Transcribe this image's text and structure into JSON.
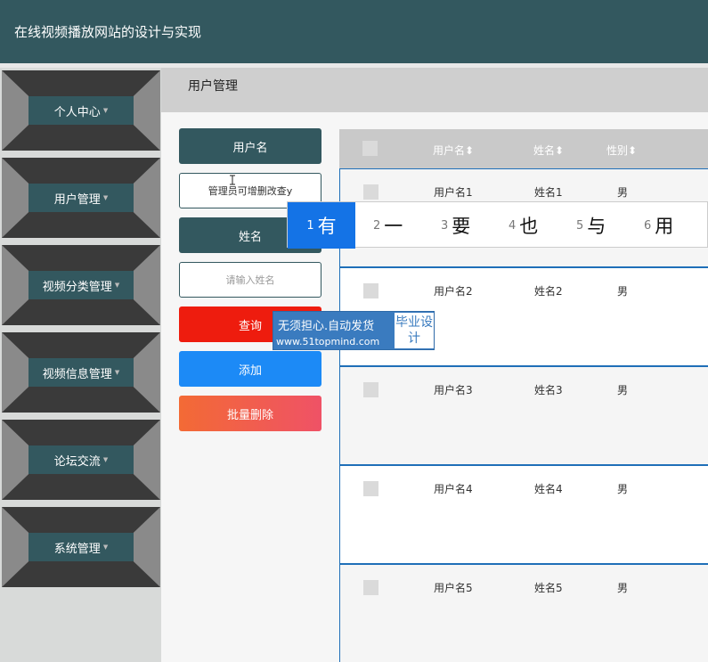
{
  "header": {
    "title": "在线视频播放网站的设计与实现"
  },
  "sidebar": {
    "items": [
      {
        "label": "个人中心"
      },
      {
        "label": "用户管理"
      },
      {
        "label": "视频分类管理"
      },
      {
        "label": "视频信息管理"
      },
      {
        "label": "论坛交流"
      },
      {
        "label": "系统管理"
      }
    ],
    "caret": "▼"
  },
  "breadcrumb": {
    "current": "用户管理"
  },
  "search_form": {
    "username_label": "用户名",
    "username_value": "管理员可增删改查y",
    "name_label": "姓名",
    "name_placeholder": "请输入姓名",
    "search_button": "查询",
    "add_button": "添加",
    "batch_delete_button": "批量删除"
  },
  "table": {
    "columns": [
      "用户名",
      "姓名",
      "性别"
    ],
    "sort_icon": "⬍",
    "rows": [
      {
        "username": "用户名1",
        "name": "姓名1",
        "gender": "男"
      },
      {
        "username": "用户名2",
        "name": "姓名2",
        "gender": "男"
      },
      {
        "username": "用户名3",
        "name": "姓名3",
        "gender": "男"
      },
      {
        "username": "用户名4",
        "name": "姓名4",
        "gender": "男"
      },
      {
        "username": "用户名5",
        "name": "姓名5",
        "gender": "男"
      }
    ]
  },
  "ime": {
    "candidates": [
      {
        "num": "1",
        "ch": "有"
      },
      {
        "num": "2",
        "ch": "一"
      },
      {
        "num": "3",
        "ch": "要"
      },
      {
        "num": "4",
        "ch": "也"
      },
      {
        "num": "5",
        "ch": "与"
      },
      {
        "num": "6",
        "ch": "用"
      }
    ]
  },
  "watermark": {
    "line1": "无须担心.自动发货",
    "line2": "www.51topmind.com",
    "badge": "毕业设计"
  },
  "colors": {
    "header_bg": "#33585f",
    "search_red": "#ee1c0e",
    "add_blue": "#1c8af6",
    "delete_orange": "#f36a35",
    "ime_selected": "#1473e6"
  }
}
